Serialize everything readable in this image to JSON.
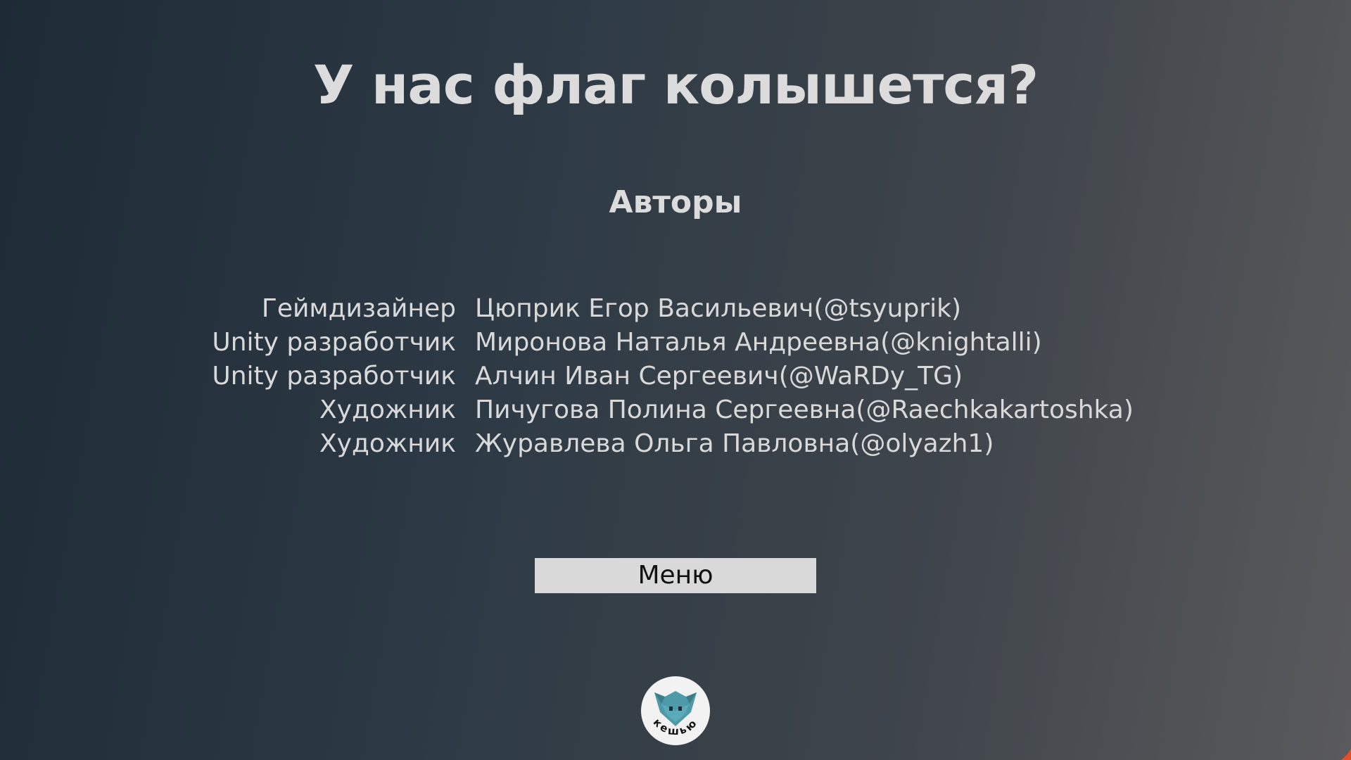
{
  "title": "У нас флаг колышется?",
  "subtitle": "Авторы",
  "credits": [
    {
      "role": "Геймдизайнер",
      "name": "Цюприк Егор Васильевич(@tsyuprik)"
    },
    {
      "role": "Unity разработчик",
      "name": "Миронова Наталья Андреевна(@knightalli)"
    },
    {
      "role": "Unity разработчик",
      "name": "Алчин Иван Сергеевич(@WaRDy_TG)"
    },
    {
      "role": "Художник",
      "name": "Пичугова Полина Сергеевна(@Raechkakartoshka)"
    },
    {
      "role": "Художник",
      "name": "Журавлева Ольга Павловна(@olyazh1)"
    }
  ],
  "menu_button": {
    "label": "Меню"
  },
  "logo": {
    "text": "кешью",
    "icon": "fox-head-icon"
  },
  "colors": {
    "background_start": "#1e2b36",
    "background_end": "#5a5a5c",
    "text": "#dcdcdc",
    "button_bg": "#d9d9d9",
    "logo_teal": "#4e9aa8",
    "accent_orange": "#e0522a"
  }
}
